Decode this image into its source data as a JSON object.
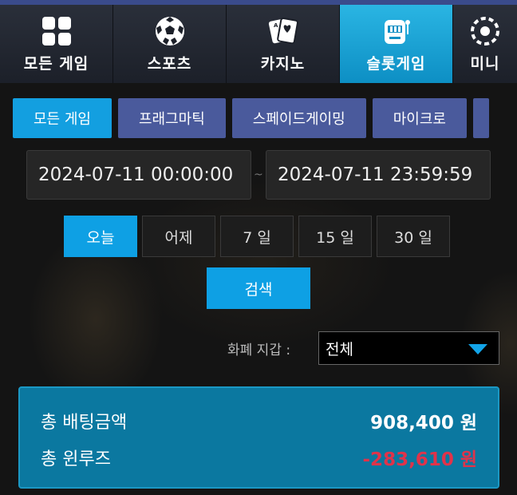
{
  "nav": {
    "categories": [
      {
        "label": "모든 게임",
        "icon": "grid-icon"
      },
      {
        "label": "스포츠",
        "icon": "soccer-ball-icon"
      },
      {
        "label": "카지노",
        "icon": "playing-cards-icon"
      },
      {
        "label": "슬롯게임",
        "icon": "slot-machine-icon"
      },
      {
        "label": "미니",
        "icon": "mini-game-icon"
      }
    ],
    "active_index": 3
  },
  "vendors": {
    "tabs": [
      "모든 게임",
      "프래그마틱",
      "스페이드게이밍",
      "마이크로"
    ],
    "active_index": 0
  },
  "date_range": {
    "start": "2024-07-11 00:00:00",
    "separator": "~",
    "end": "2024-07-11 23:59:59"
  },
  "periods": {
    "options": [
      "오늘",
      "어제",
      "7 일",
      "15 일",
      "30 일"
    ],
    "active_index": 0
  },
  "search_label": "검색",
  "currency": {
    "label": "화폐 지갑 :",
    "selected": "전체"
  },
  "summary": {
    "total_bet_label": "총 배팅금액",
    "total_bet_value": "908,400 원",
    "total_winloss_label": "총 윈루즈",
    "total_winloss_value": "-283,610 원"
  },
  "colors": {
    "accent": "#0ea0e4",
    "vendor_tab": "#4a5a9c",
    "summary_bg": "#0b78a0",
    "negative": "#e0334a"
  }
}
